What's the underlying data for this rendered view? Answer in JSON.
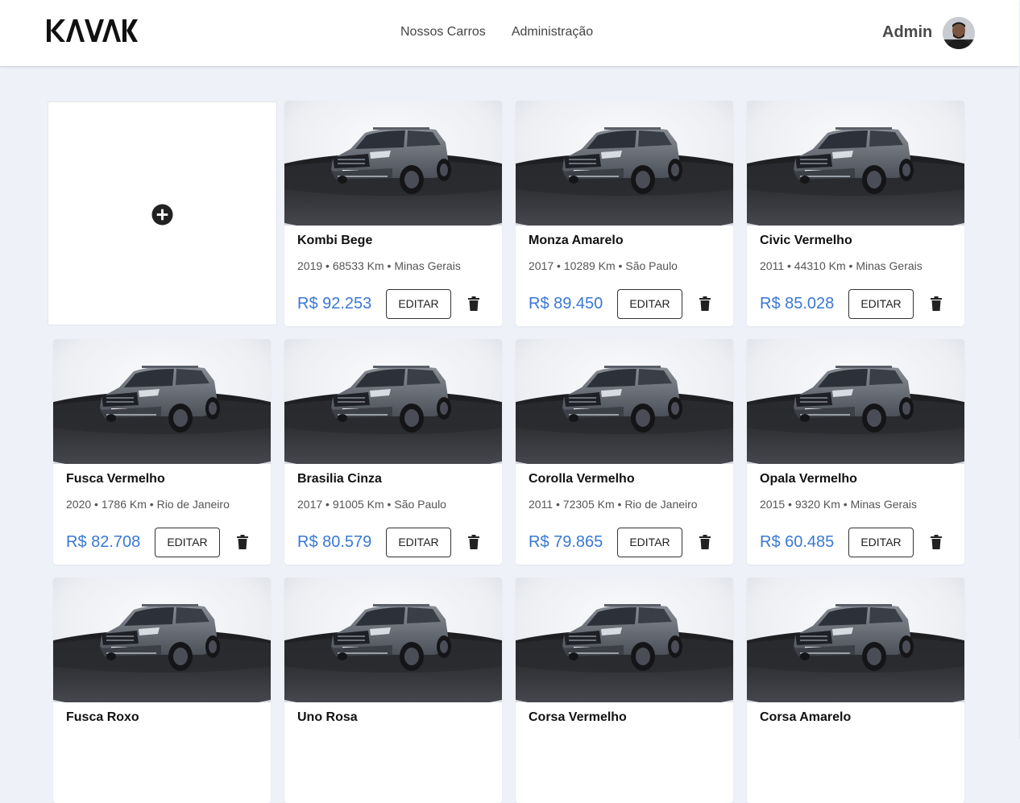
{
  "header": {
    "logo_text": "KAVAK",
    "nav": [
      "Nossos Carros",
      "Administração"
    ],
    "user_name": "Admin"
  },
  "cards": [
    {
      "title": "Kombi Bege",
      "year": "2019",
      "km": "68533 Km",
      "location": "Minas Gerais",
      "price": "R$ 92.253",
      "edit_label": "EDITAR"
    },
    {
      "title": "Monza Amarelo",
      "year": "2017",
      "km": "10289 Km",
      "location": "São Paulo",
      "price": "R$ 89.450",
      "edit_label": "EDITAR"
    },
    {
      "title": "Civic Vermelho",
      "year": "2011",
      "km": "44310 Km",
      "location": "Minas Gerais",
      "price": "R$ 85.028",
      "edit_label": "EDITAR"
    },
    {
      "title": "Fusca Vermelho",
      "year": "2020",
      "km": "1786 Km",
      "location": "Rio de Janeiro",
      "price": "R$ 82.708",
      "edit_label": "EDITAR"
    },
    {
      "title": "Brasilia Cinza",
      "year": "2017",
      "km": "91005 Km",
      "location": "São Paulo",
      "price": "R$ 80.579",
      "edit_label": "EDITAR"
    },
    {
      "title": "Corolla Vermelho",
      "year": "2011",
      "km": "72305 Km",
      "location": "Rio de Janeiro",
      "price": "R$ 79.865",
      "edit_label": "EDITAR"
    },
    {
      "title": "Opala Vermelho",
      "year": "2015",
      "km": "9320 Km",
      "location": "Minas Gerais",
      "price": "R$ 60.485",
      "edit_label": "EDITAR"
    },
    {
      "title": "Fusca Roxo",
      "year": "",
      "km": "",
      "location": "",
      "price": "",
      "edit_label": ""
    },
    {
      "title": "Uno Rosa",
      "year": "",
      "km": "",
      "location": "",
      "price": "",
      "edit_label": ""
    },
    {
      "title": "Corsa Vermelho",
      "year": "",
      "km": "",
      "location": "",
      "price": "",
      "edit_label": ""
    },
    {
      "title": "Corsa Amarelo",
      "year": "",
      "km": "",
      "location": "",
      "price": "",
      "edit_label": ""
    }
  ],
  "icons": {
    "add": "plus-circle-icon",
    "delete": "trash-icon"
  },
  "colors": {
    "price": "#3a78d4",
    "background": "#eef1f7",
    "card": "#ffffff"
  }
}
